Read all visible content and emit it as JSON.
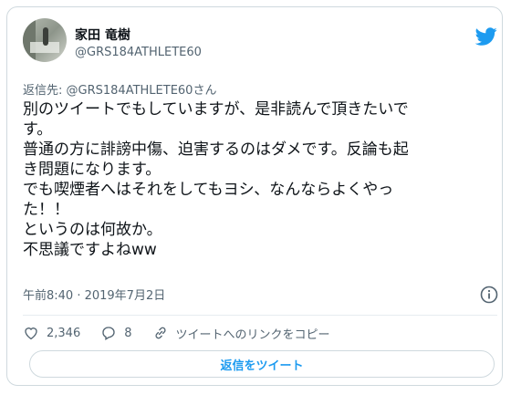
{
  "author": {
    "display_name": "家田 竜樹",
    "handle": "@GRS184ATHLETE60"
  },
  "reply_to": {
    "prefix": "返信先:",
    "handle": "@GRS184ATHLETE60",
    "suffix": "さん"
  },
  "tweet": {
    "lines": [
      "別のツイートでもしていますが、是非読んで頂きたいで",
      "す。",
      "普通の方に誹謗中傷、迫害するのはダメです。反論も起",
      "き問題になります。",
      "でも喫煙者へはそれをしてもヨシ、なんならよくやっ",
      "た！！",
      "というのは何故か。",
      "不思議ですよねww"
    ],
    "timestamp": "午前8:40 · 2019年7月2日"
  },
  "actions": {
    "likes": "2,346",
    "replies": "8",
    "copy_link": "ツイートへのリンクをコピー"
  },
  "reply_button": "返信をツイート",
  "colors": {
    "brand_blue": "#1d9bf0",
    "muted_text": "#536471",
    "border": "#cfd9de"
  },
  "icons": [
    "twitter-bird-icon",
    "info-icon",
    "heart-icon",
    "reply-bubble-icon",
    "link-icon"
  ]
}
